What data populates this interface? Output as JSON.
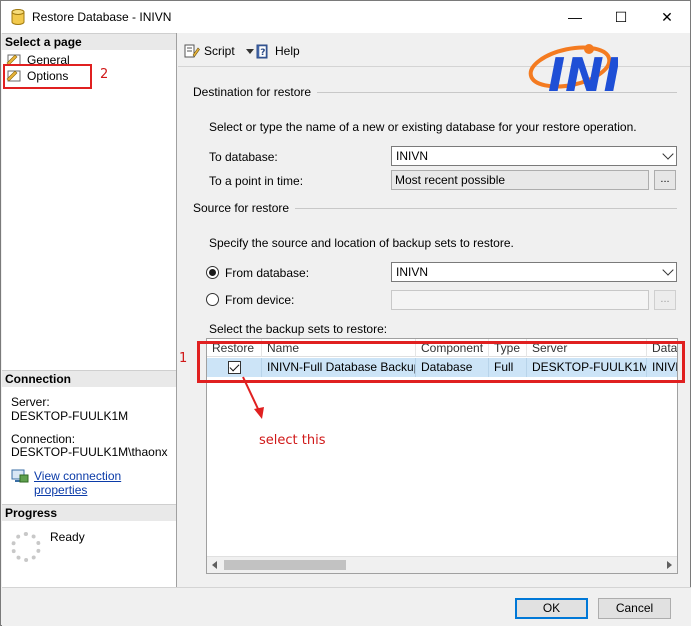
{
  "window": {
    "title": "Restore Database - INIVN",
    "minimize": "—",
    "maximize": "☐",
    "close": "✕"
  },
  "sidebar": {
    "select_page_header": "Select a page",
    "pages": [
      {
        "label": "General"
      },
      {
        "label": "Options"
      }
    ],
    "connection_header": "Connection",
    "server_label": "Server:",
    "server_value": "DESKTOP-FUULK1M",
    "connection_label": "Connection:",
    "connection_value": "DESKTOP-FUULK1M\\thaonx",
    "view_connection_link": "View connection properties",
    "progress_header": "Progress",
    "progress_status": "Ready"
  },
  "toolbar": {
    "script_label": "Script",
    "help_label": "Help"
  },
  "logo": {
    "text": "INI",
    "accent_color": "#f47b20",
    "brand_color": "#1e4fd6"
  },
  "destination": {
    "section_title": "Destination for restore",
    "instruction": "Select or type the name of a new or existing database for your restore operation.",
    "to_database_label": "To database:",
    "to_database_value": "INIVN",
    "point_in_time_label": "To a point in time:",
    "point_in_time_value": "Most recent possible",
    "browse_label": "..."
  },
  "source": {
    "section_title": "Source for restore",
    "instruction": "Specify the source and location of backup sets to restore.",
    "from_database_label": "From database:",
    "from_database_value": "INIVN",
    "from_device_label": "From device:",
    "from_device_value": "",
    "browse_label": "...",
    "backup_sets_label": "Select the backup sets to restore:",
    "columns": [
      "Restore",
      "Name",
      "Component",
      "Type",
      "Server",
      "Datab"
    ],
    "rows": [
      {
        "restore": true,
        "name": "INIVN-Full Database Backup",
        "component": "Database",
        "type": "Full",
        "server": "DESKTOP-FUULK1M",
        "database": "INIVN"
      }
    ]
  },
  "annotations": {
    "box1_number": "1",
    "box2_number": "2",
    "note": "select this",
    "color": "#e02020"
  },
  "footer": {
    "ok_label": "OK",
    "cancel_label": "Cancel"
  }
}
